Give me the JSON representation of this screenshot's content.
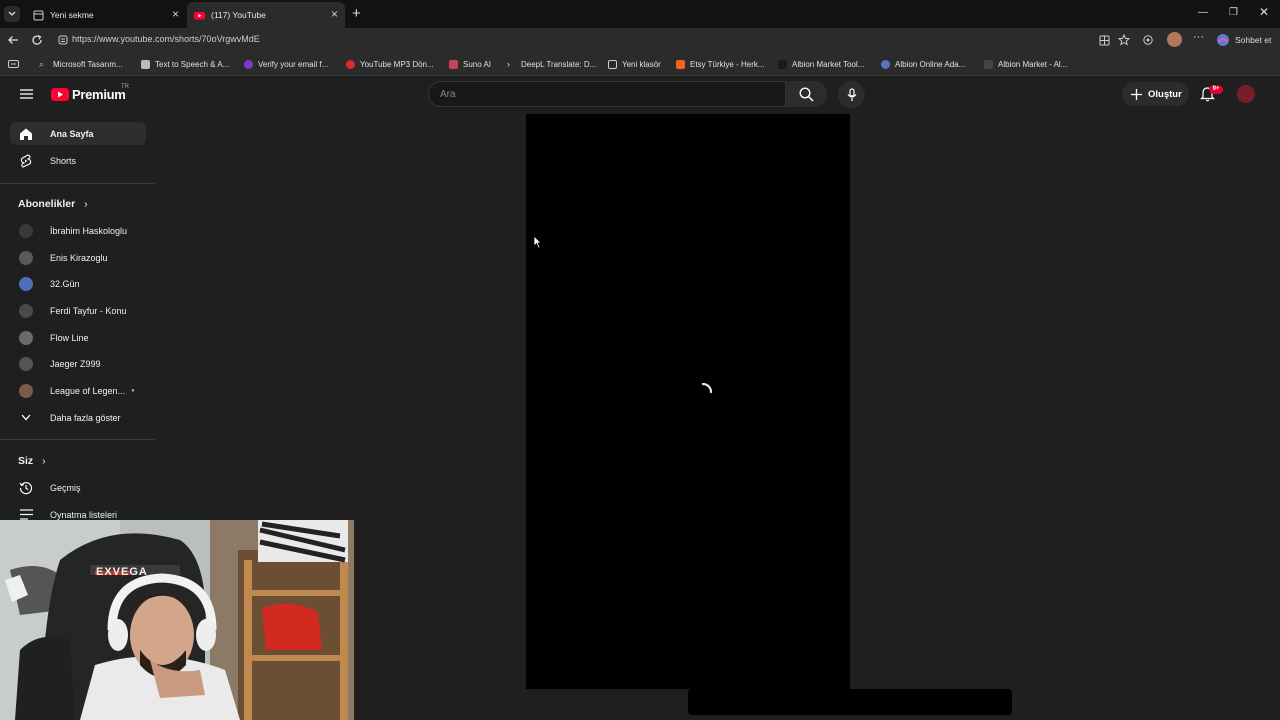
{
  "browser": {
    "tabs": [
      {
        "title": "Yeni sekme",
        "active": false
      },
      {
        "title": "(117) YouTube",
        "active": true
      }
    ],
    "url": "https://www.youtube.com/shorts/70oVrgwvMdE",
    "copilot_label": "Sohbet et",
    "bookmarks": [
      "Microsoft Tasarım...",
      "Text to Speech & A...",
      "Verify your email f...",
      "YouTube MP3 Dön...",
      "Suno AI",
      "DeepL Translate: D...",
      "Yeni klasör",
      "Etsy Türkiye - Herk...",
      "Albion Market Tool...",
      "Albion Online Ada...",
      "Albion Market - Al..."
    ]
  },
  "youtube": {
    "logo_text": "Premium",
    "region": "TR",
    "search_placeholder": "Ara",
    "create_label": "Oluştur",
    "notification_count": "9+",
    "sidebar": {
      "main": [
        {
          "label": "Ana Sayfa",
          "icon": "home-icon",
          "active": true
        },
        {
          "label": "Shorts",
          "icon": "shorts-icon",
          "active": false
        }
      ],
      "subscriptions_title": "Abonelikler",
      "subscriptions": [
        {
          "label": "İbrahim Haskologlu",
          "color": "#3a3a3a"
        },
        {
          "label": "Enis Kirazoglu",
          "color": "#5b5b5b"
        },
        {
          "label": "32.Gün",
          "color": "#4e6fb8"
        },
        {
          "label": "Ferdi Tayfur - Konu",
          "color": "#4a4a4a"
        },
        {
          "label": "Flow Line",
          "color": "#6a6a6a"
        },
        {
          "label": "Jaeger Z999",
          "color": "#555555"
        },
        {
          "label": "League of Legen...",
          "color": "#7b5a4a"
        }
      ],
      "show_more": "Daha fazla göster",
      "you_title": "Siz",
      "you_items": [
        {
          "label": "Geçmiş",
          "icon": "history-icon"
        },
        {
          "label": "Oynatma listeleri",
          "icon": "playlist-icon"
        }
      ]
    }
  },
  "colors": {
    "youtube_red": "#ff0033",
    "badge_red": "#e1002d",
    "active_item_bg": "#2e2e2e"
  }
}
